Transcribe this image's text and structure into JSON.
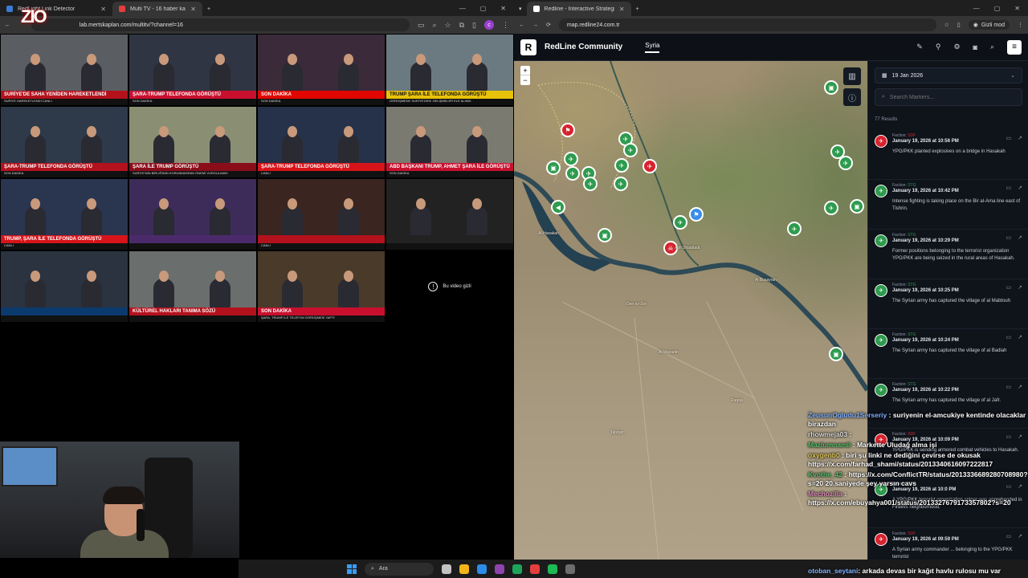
{
  "left_browser": {
    "tabs": [
      {
        "label": "RedLight Link Detector"
      },
      {
        "label": "Multi TV - 16 haber kanalını ay"
      }
    ],
    "url": "lab.mertskaplan.com/multitv/?channel=16",
    "profile_initial": "c",
    "window_controls": [
      "—",
      "▢",
      "✕"
    ]
  },
  "stream_logo": "ZIO",
  "tv_channels": [
    {
      "banner": "SURİYE'DE SAHA YENİDEN HAREKETLENDİ",
      "banner_color": "#b3121d",
      "sub": "SURİYE HAREKETLENDİ CANLI"
    },
    {
      "banner": "ŞARA-TRUMP TELEFONDA GÖRÜŞTÜ",
      "banner_color": "#c8102e",
      "sub": "SON DAKİKA"
    },
    {
      "banner": "SON DAKİKA",
      "banner_color": "#e10600",
      "sub": "SON DAKİKA"
    },
    {
      "banner": "TRUMP ŞARA İLE TELEFONDA GÖRÜŞTÜ",
      "banner_color": "#e8c20a",
      "sub": "GÖRÜŞMEDE SURİYE'DEKİ GELİŞMELER ELE ALINDI"
    },
    {
      "banner": "ŞARA-TRUMP TELEFONDA GÖRÜŞTÜ",
      "banner_color": "#b3121d",
      "sub": "SON DAKİKA"
    },
    {
      "banner": "ŞARA İLE TRUMP GÖRÜŞTÜ",
      "banner_color": "#8a0d1a",
      "sub": "SURİYE'NİN BİRLİĞİNİN KORUNMASININ ÖNEMİ VURGULANDI"
    },
    {
      "banner": "ŞARA-TRUMP TELEFONDA GÖRÜŞTÜ",
      "banner_color": "#d7141a",
      "sub": "CANLI"
    },
    {
      "banner": "ABD BAŞKANI TRUMP, AHMET ŞARA İLE GÖRÜŞTÜ",
      "banner_color": "#c8102e",
      "sub": "SON DAKİKA"
    },
    {
      "banner": "TRUMP, ŞARA İLE TELEFONDA GÖRÜŞTÜ",
      "banner_color": "#d7141a",
      "sub": "CANLI"
    },
    {
      "banner": "",
      "banner_color": "#4b2a6b",
      "sub": ""
    },
    {
      "banner": "",
      "banner_color": "#b3121d",
      "sub": "CANLI"
    },
    {
      "banner": "",
      "banner_color": "#222",
      "sub": ""
    },
    {
      "banner": "",
      "banner_color": "#0b3a6e",
      "sub": ""
    },
    {
      "banner": "KÜLTÜREL HAKLARI TANIMA SÖZÜ",
      "banner_color": "#b3121d",
      "sub": ""
    },
    {
      "banner": "SON DAKİKA",
      "banner_color": "#c8102e",
      "sub": "ŞARA, TRUMP İLE TELEFON GÖRÜŞMESİ YAPTI"
    },
    {
      "banner": "",
      "banner_color": "#000",
      "sub": "",
      "hidden_text": "Bu video gizli"
    }
  ],
  "taskbar": {
    "search_placeholder": "Ara",
    "icon_colors": [
      "#c2c2c2",
      "#f2b418",
      "#2c8be8",
      "#8e44ad",
      "#1fa35b",
      "#e53e3e",
      "#1db954",
      "#6d6d6d"
    ]
  },
  "right_browser": {
    "tab_label": "Redline - Interactive Strategic M",
    "url": "map.redline24.com.tr",
    "incognito_label": "Gizli mod"
  },
  "app": {
    "brand_letter": "R",
    "brand_name": "RedLine Community",
    "nav_tab": "Syria",
    "date_value": "19 Jan 2026",
    "search_placeholder": "Search Markers...",
    "results_count": "77 Results"
  },
  "map_places": [
    "Al-Hasakah",
    "Ash Shaddadi",
    "Al Busayrah",
    "Deir ez-Zor",
    "Al Mayadin",
    "Raqqa",
    "Tabqah"
  ],
  "events": [
    {
      "faction": "SDF",
      "faction_color": "#d7232f",
      "date": "January 19, 2026 at 10:56 PM",
      "text": "YPG/PKK planted explosives on a bridge in Hasakah",
      "icon_color": "#d7232f"
    },
    {
      "faction": "STG",
      "faction_color": "#2e9b4e",
      "date": "January 19, 2026 at 10:42 PM",
      "text": "Intense fighting is taking place on the Bir al-Ama line east of Tishrin.",
      "icon_color": "#2e9b4e"
    },
    {
      "faction": "STG",
      "faction_color": "#2e9b4e",
      "date": "January 19, 2026 at 10:29 PM",
      "text": "Former positions belonging to the terrorist organization YPG/PKK are being seized in the rural areas of Hasakah.",
      "icon_color": "#2e9b4e"
    },
    {
      "faction": "STG",
      "faction_color": "#2e9b4e",
      "date": "January 19, 2026 at 10:25 PM",
      "text": "The Syrian army has captured the village of al Mabtouh",
      "icon_color": "#2e9b4e"
    },
    {
      "faction": "STG",
      "faction_color": "#2e9b4e",
      "date": "January 19, 2026 at 10:24 PM",
      "text": "The Syrian army has captured the village of al Badiah",
      "icon_color": "#2e9b4e"
    },
    {
      "faction": "STG",
      "faction_color": "#2e9b4e",
      "date": "January 19, 2026 at 10:22 PM",
      "text": "The Syrian army has captured the village of al Jafr.",
      "icon_color": "#2e9b4e"
    },
    {
      "faction": "SDF",
      "faction_color": "#d7232f",
      "date": "January 19, 2026 at 10:09 PM",
      "text": "YPG/PKK is sending armored combat vehicles to Hasakah.",
      "icon_color": "#d7232f"
    },
    {
      "faction": "STG",
      "faction_color": "#2e9b4e",
      "date": "January 19, 2026 at 10:0 PM",
      "text": "A YPG/PKK terrorist organization sniper was apprehended in Firdevs neighborhood.",
      "icon_color": "#2e9b4e"
    },
    {
      "faction": "SDF",
      "faction_color": "#d7232f",
      "date": "January 19, 2026 at 09:59 PM",
      "text": "A Syrian army commander ... belonging to the YPG/PKK terrorist",
      "icon_color": "#d7232f"
    }
  ],
  "chat": [
    {
      "user": "ZeusunOgludu1Serseriy",
      "user_color": "blue",
      "text": ": suriyenin el-amcukiye kentinde olacaklar birazdan"
    },
    {
      "user": "rhowmeja03",
      "user_color": "white",
      "text": ":"
    },
    {
      "user": "Mazlumnamli",
      "user_color": "",
      "text": ": Markette Uludağ alma işi"
    },
    {
      "user": "oxygenb0",
      "user_color": "yellow",
      "text": ": biri şu linki ne dediğini çevirse de okusak https://x.com/farhad_shami/status/2013340616097222817"
    },
    {
      "user": "Kvothe_42",
      "user_color": "",
      "text": ": https://x.com/ConflictTR/status/2013336689280708980?s=20 20.saniyede şey yarsın cavs"
    },
    {
      "user": "Mechozilla",
      "user_color": "pink",
      "text": ": https://x.com/ebuyahya001/status/2013327679173357802?s=20"
    }
  ],
  "chat_last": {
    "user": "otoban_seytani",
    "text": ": arkada devas bir kağıt havlu rulosu mu var"
  }
}
